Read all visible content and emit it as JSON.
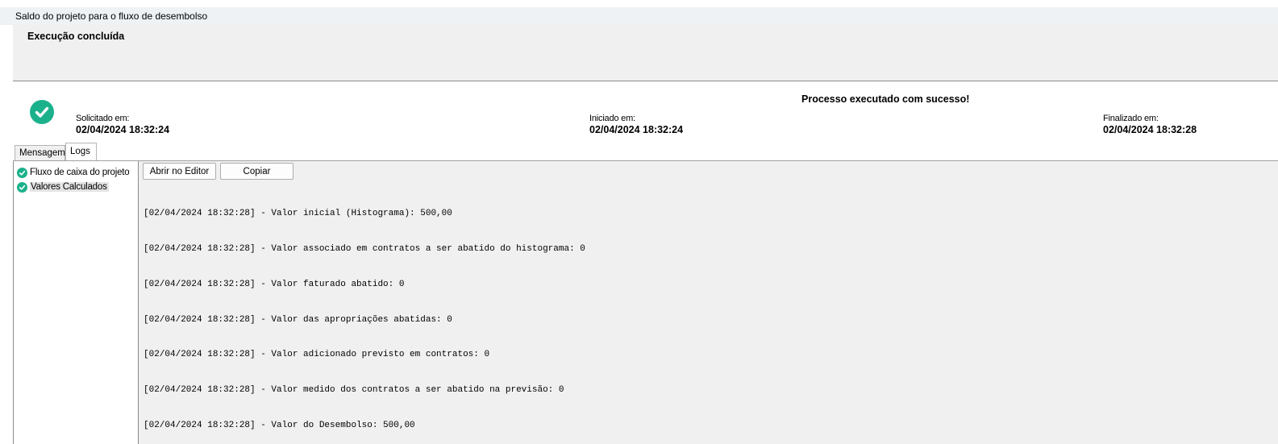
{
  "window": {
    "title": "Saldo do projeto para o fluxo de desembolso"
  },
  "header": {
    "state_title": "Execução concluída"
  },
  "status": {
    "icon": "check-circle-icon",
    "color": "#1bb18b",
    "message": "Processo executado com sucesso!",
    "requested_label": "Solicitado em:",
    "requested_value": "02/04/2024 18:32:24",
    "started_label": "Iniciado em:",
    "started_value": "02/04/2024 18:32:24",
    "finished_label": "Finalizado em:",
    "finished_value": "02/04/2024 18:32:28"
  },
  "tabs": [
    {
      "label": "Mensagem",
      "active": false
    },
    {
      "label": "Logs",
      "active": true
    }
  ],
  "tree": {
    "items": [
      {
        "label": "Fluxo de caixa do projeto",
        "icon": "check-circle-icon",
        "selected": false
      },
      {
        "label": "Valores Calculados",
        "icon": "check-circle-icon",
        "selected": true
      }
    ]
  },
  "toolbar": {
    "open_editor_label": "Abrir no Editor",
    "copy_label": "Copiar"
  },
  "log": {
    "lines": [
      "[02/04/2024 18:32:28] - Valor inicial (Histograma): 500,00",
      "[02/04/2024 18:32:28] - Valor associado em contratos a ser abatido do histograma: 0",
      "[02/04/2024 18:32:28] - Valor faturado abatido: 0",
      "[02/04/2024 18:32:28] - Valor das apropriações abatidas: 0",
      "[02/04/2024 18:32:28] - Valor adicionado previsto em contratos: 0",
      "[02/04/2024 18:32:28] - Valor medido dos contratos a ser abatido na previsão: 0",
      "[02/04/2024 18:32:28] - Valor do Desembolso: 500,00"
    ]
  }
}
